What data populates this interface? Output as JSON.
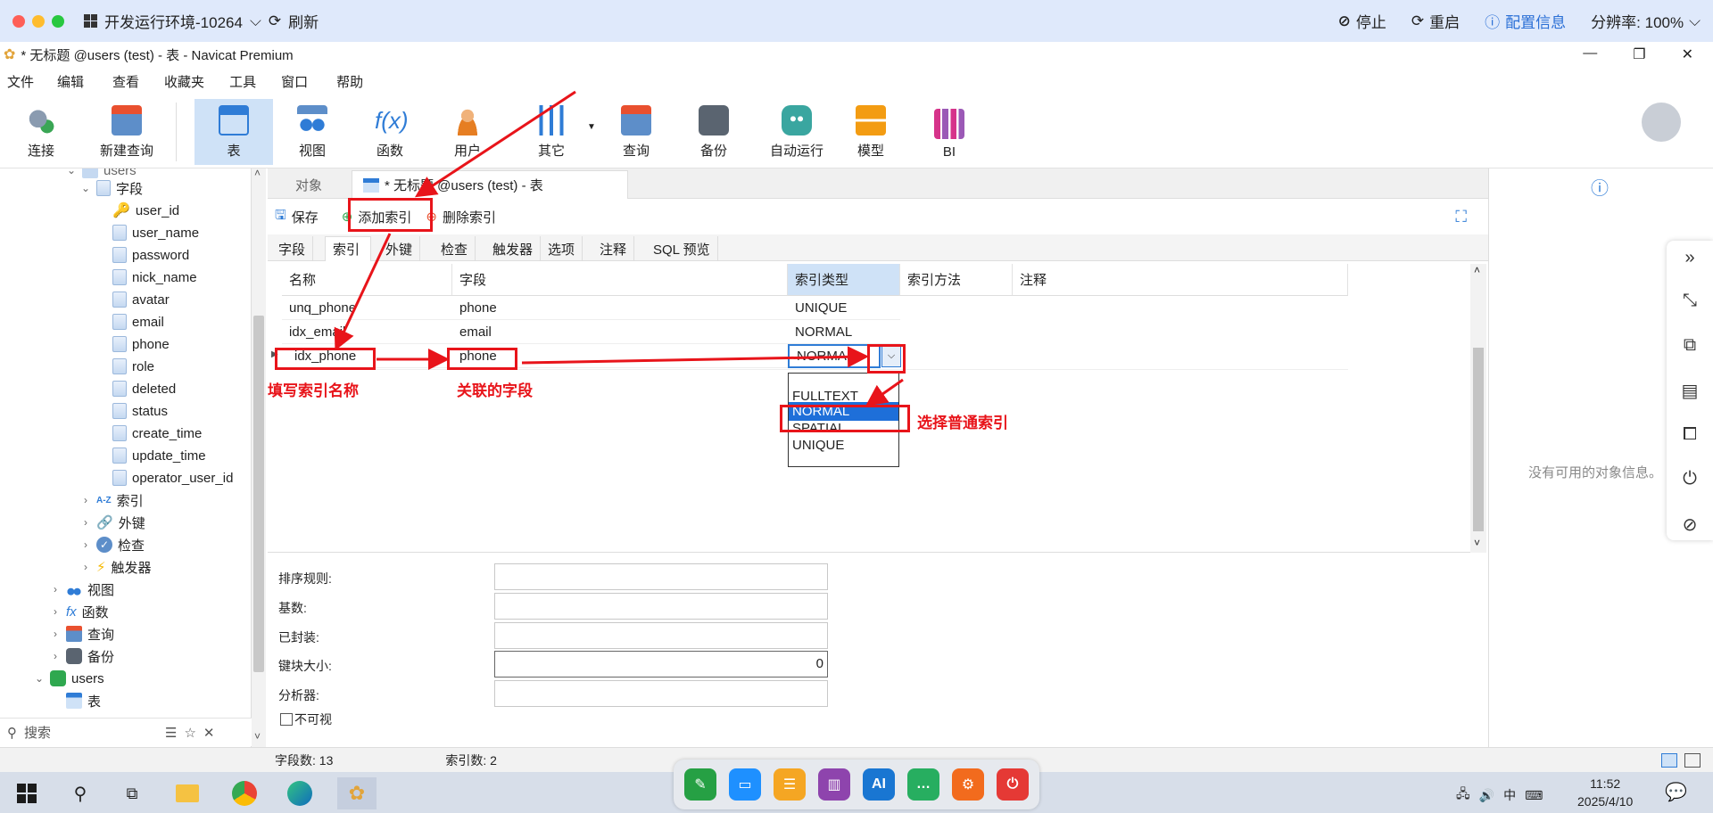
{
  "remote_bar": {
    "env_title": "开发运行环境-10264",
    "refresh": "刷新",
    "stop": "停止",
    "restart": "重启",
    "config": "配置信息",
    "resolution": "分辨率: 100%"
  },
  "window": {
    "title": "* 无标题 @users (test) - 表 - Navicat Premium"
  },
  "menu": [
    "文件",
    "编辑",
    "查看",
    "收藏夹",
    "工具",
    "窗口",
    "帮助"
  ],
  "toolbar": {
    "connect": "连接",
    "new_query": "新建查询",
    "table": "表",
    "view": "视图",
    "function": "函数",
    "user": "用户",
    "other": "其它",
    "query": "查询",
    "backup": "备份",
    "automation": "自动运行",
    "model": "模型",
    "bi": "BI"
  },
  "tree": {
    "db_top": "users",
    "fields_label": "字段",
    "fields": [
      "user_id",
      "user_name",
      "password",
      "nick_name",
      "avatar",
      "email",
      "phone",
      "role",
      "deleted",
      "status",
      "create_time",
      "update_time",
      "operator_user_id"
    ],
    "index": "索引",
    "fk": "外键",
    "check": "检查",
    "trigger": "触发器",
    "views": "视图",
    "functions": "函数",
    "queries": "查询",
    "backups": "备份",
    "db_users": "users",
    "tables": "表",
    "search_placeholder": "搜索"
  },
  "tabs": {
    "object": "对象",
    "table_tab": "* 无标题 @users (test) - 表"
  },
  "actions": {
    "save": "保存",
    "add_index": "添加索引",
    "delete_index": "删除索引"
  },
  "subtabs": [
    "字段",
    "索引",
    "外键",
    "检查",
    "触发器",
    "选项",
    "注释",
    "SQL 预览"
  ],
  "grid": {
    "headers": [
      "名称",
      "字段",
      "索引类型",
      "索引方法",
      "注释"
    ],
    "rows": [
      {
        "name": "unq_phone",
        "field": "phone",
        "type": "UNIQUE"
      },
      {
        "name": "idx_email",
        "field": "email",
        "type": "NORMAL"
      },
      {
        "name": "idx_phone",
        "field": "phone",
        "type": "NORMAL"
      }
    ],
    "dropdown_options": [
      "FULLTEXT",
      "NORMAL",
      "SPATIAL",
      "UNIQUE"
    ],
    "dropdown_selected": "NORMAL"
  },
  "props": {
    "collation": "排序规则:",
    "cardinality": "基数:",
    "packed": "已封装:",
    "key_block_size": "键块大小:",
    "key_block_value": "0",
    "parser": "分析器:",
    "invisible": "不可视"
  },
  "status": {
    "field_count": "字段数: 13",
    "index_count": "索引数: 2"
  },
  "info_panel": {
    "no_info": "没有可用的对象信息。"
  },
  "annotations": {
    "fill_name": "填写索引名称",
    "related_field": "关联的字段",
    "choose_normal": "选择普通索引"
  },
  "clock": {
    "time": "11:52",
    "date": "2025/4/10",
    "ime": "中"
  },
  "colors": {
    "accent_blue": "#2a6fd6",
    "annotation_red": "#e8141a",
    "selection_blue": "#1e6fd9"
  }
}
